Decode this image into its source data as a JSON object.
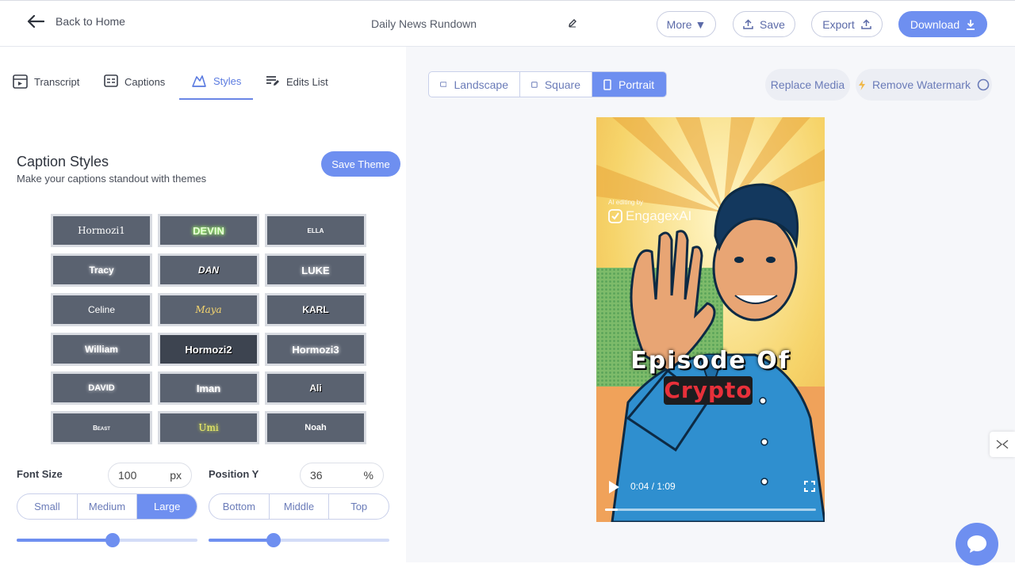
{
  "header": {
    "back_label": "Back to Home",
    "doc_title": "Daily News Rundown",
    "more_label": "More ▼",
    "save_label": "Save",
    "export_label": "Export",
    "download_label": "Download"
  },
  "tabs": [
    {
      "label": "Transcript",
      "icon": "transcript-icon"
    },
    {
      "label": "Captions",
      "icon": "captions-icon"
    },
    {
      "label": "Styles",
      "icon": "styles-icon",
      "active": true
    },
    {
      "label": "Edits List",
      "icon": "edits-list-icon"
    }
  ],
  "caption_styles": {
    "title": "Caption Styles",
    "subtitle": "Make your captions standout with themes",
    "save_theme_label": "Save Theme",
    "themes": [
      "Hormozi1",
      "DEVIN",
      "ELLA",
      "Tracy",
      "DAN",
      "LUKE",
      "Celine",
      "Maya",
      "KARL",
      "William",
      "Hormozi2",
      "Hormozi3",
      "DAVID",
      "Iman",
      "Ali",
      "Beast",
      "Umi",
      "Noah"
    ]
  },
  "font_size": {
    "label": "Font Size",
    "value": "100",
    "unit": "px",
    "options": [
      "Small",
      "Medium",
      "Large"
    ],
    "selected": "Large",
    "slider_level": 0.53
  },
  "position_y": {
    "label": "Position Y",
    "value": "36",
    "unit": "%",
    "options": [
      "Bottom",
      "Middle",
      "Top"
    ],
    "selected": null,
    "slider_level": 0.36
  },
  "orientation": {
    "options": [
      "Landscape",
      "Square",
      "Portrait"
    ],
    "selected": "Portrait"
  },
  "replace_media_label": "Replace Media",
  "remove_watermark_label": "Remove Watermark",
  "video": {
    "watermark_small": "AI editing by",
    "watermark_brand": "EngagexAI",
    "caption_line1": "Episode Of",
    "caption_line2": "Crypto",
    "time_display": "0:04 / 1:09",
    "progress": 0.06
  },
  "colors": {
    "accent": "#6e8ff0",
    "theme_tile": "#5a6270",
    "caption_highlight": "#e8303a"
  }
}
